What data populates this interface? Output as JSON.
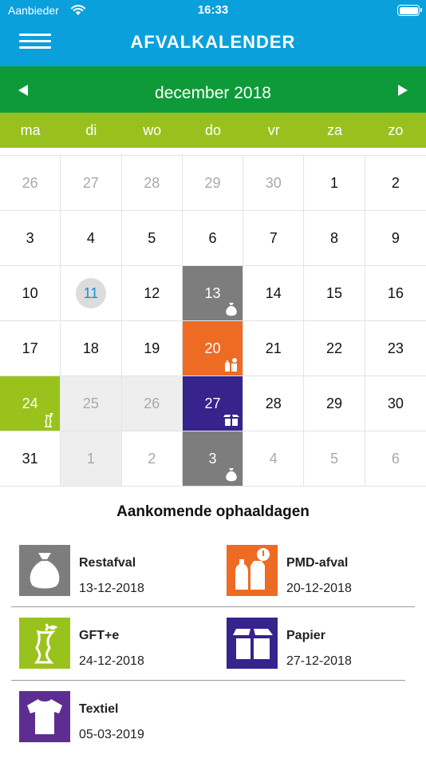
{
  "status": {
    "carrier": "Aanbieder",
    "time": "16:33",
    "battery_level": 1.0
  },
  "header": {
    "title": "AFVALKALENDER",
    "menu_icon": "hamburger-menu-icon"
  },
  "calendar": {
    "month": "december 2018",
    "prev_icon": "triangle-left-icon",
    "next_icon": "triangle-right-icon",
    "weekdays": [
      "ma",
      "di",
      "wo",
      "do",
      "vr",
      "za",
      "zo"
    ],
    "today": "11",
    "days": [
      {
        "d": "26",
        "muted": true
      },
      {
        "d": "27",
        "muted": true
      },
      {
        "d": "28",
        "muted": true
      },
      {
        "d": "29",
        "muted": true
      },
      {
        "d": "30",
        "muted": true
      },
      {
        "d": "1"
      },
      {
        "d": "2"
      },
      {
        "d": "3"
      },
      {
        "d": "4"
      },
      {
        "d": "5"
      },
      {
        "d": "6"
      },
      {
        "d": "7"
      },
      {
        "d": "8"
      },
      {
        "d": "9"
      },
      {
        "d": "10"
      },
      {
        "d": "11",
        "today": true
      },
      {
        "d": "12"
      },
      {
        "d": "13",
        "type": "rest"
      },
      {
        "d": "14"
      },
      {
        "d": "15"
      },
      {
        "d": "16"
      },
      {
        "d": "17"
      },
      {
        "d": "18"
      },
      {
        "d": "19"
      },
      {
        "d": "20",
        "type": "pmd"
      },
      {
        "d": "21"
      },
      {
        "d": "22"
      },
      {
        "d": "23"
      },
      {
        "d": "24",
        "type": "gft"
      },
      {
        "d": "25",
        "muted": true,
        "shaded": true
      },
      {
        "d": "26",
        "muted": true,
        "shaded": true
      },
      {
        "d": "27",
        "type": "papier"
      },
      {
        "d": "28"
      },
      {
        "d": "29"
      },
      {
        "d": "30"
      },
      {
        "d": "31"
      },
      {
        "d": "1",
        "muted": true,
        "shaded": true
      },
      {
        "d": "2",
        "muted": true
      },
      {
        "d": "3",
        "type": "rest"
      },
      {
        "d": "4",
        "muted": true
      },
      {
        "d": "5",
        "muted": true
      },
      {
        "d": "6",
        "muted": true
      }
    ]
  },
  "colors": {
    "rest": "#7d7d7d",
    "pmd": "#ee6b23",
    "gft": "#9ac21d",
    "papier": "#36238b",
    "textiel": "#5e2d91",
    "header": "#0aa0dc",
    "month_bar": "#0e9a38",
    "weekday_bar": "#98c11d"
  },
  "upcoming": {
    "title": "Aankomende ophaaldagen",
    "items": [
      {
        "name": "Restafval",
        "date": "13-12-2018",
        "icon": "trash-bag-icon"
      },
      {
        "name": "PMD-afval",
        "date": "20-12-2018",
        "icon": "bottle-carton-icon"
      },
      {
        "name": "GFT+e",
        "date": "24-12-2018",
        "icon": "apple-core-icon"
      },
      {
        "name": "Papier",
        "date": "27-12-2018",
        "icon": "cardboard-box-icon"
      },
      {
        "name": "Textiel",
        "date": "05-03-2019",
        "icon": "tshirt-icon"
      }
    ]
  }
}
